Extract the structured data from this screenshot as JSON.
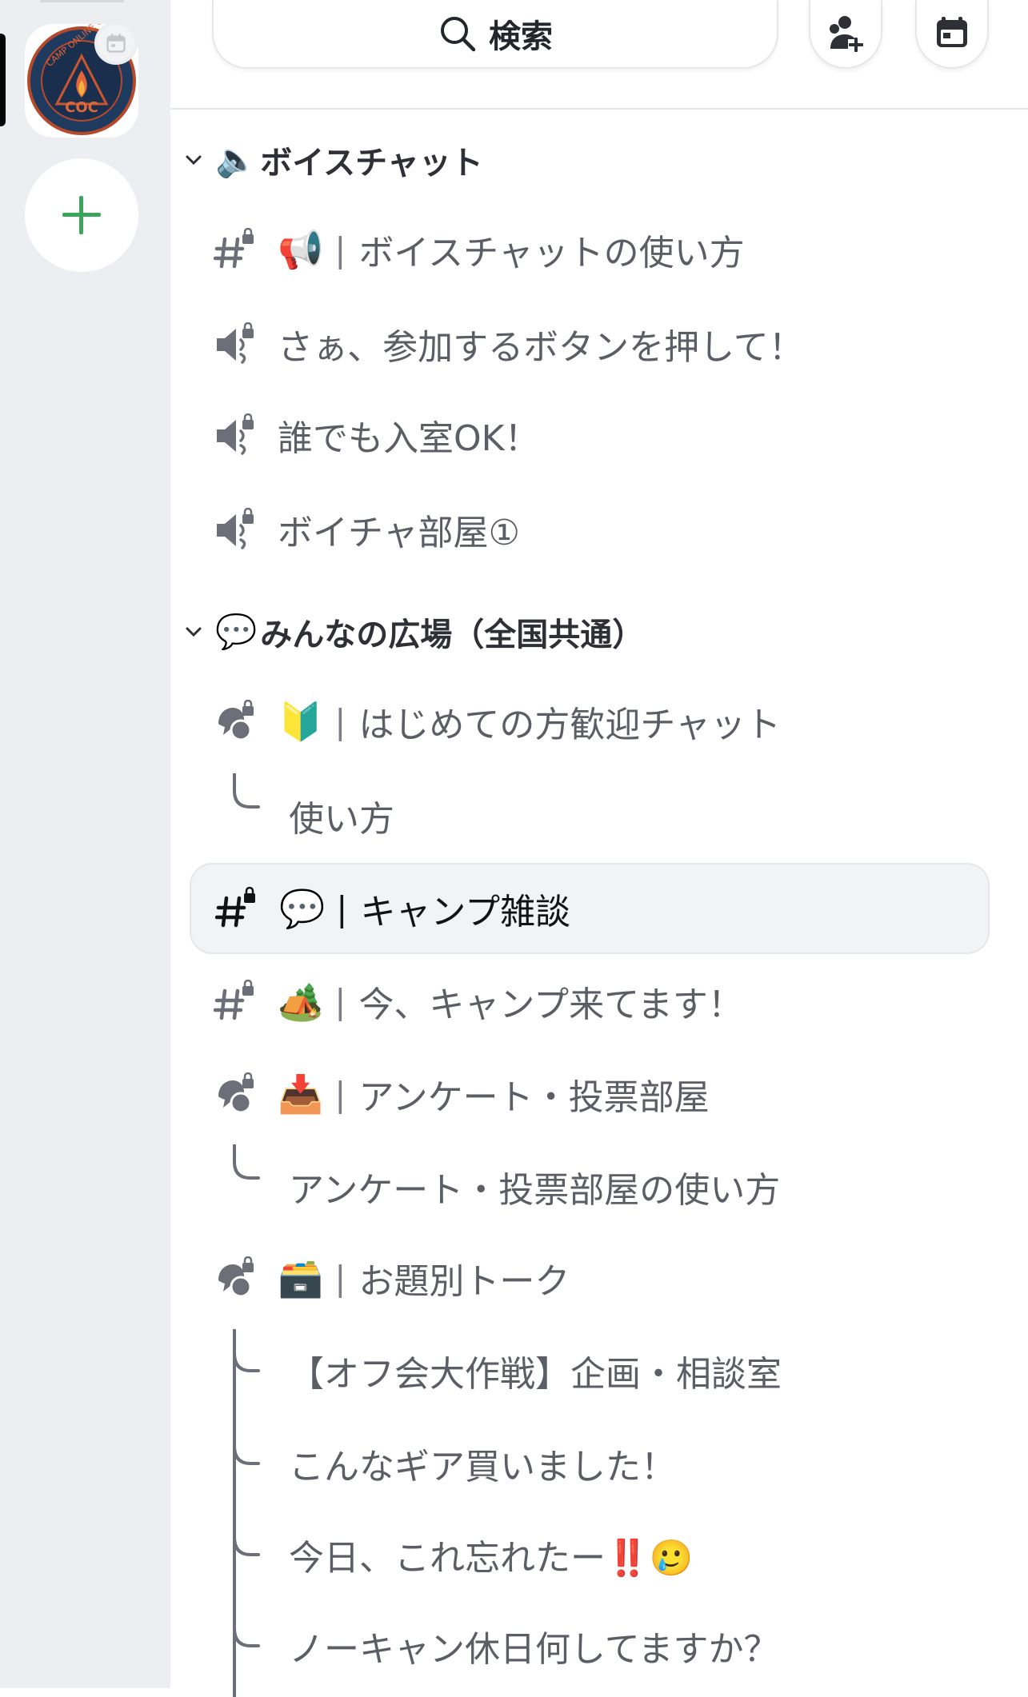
{
  "header": {
    "search_label": "検索"
  },
  "rail": {
    "server_logo_text": "COC",
    "server_logo_ring_text": "CAMP ONLINE C"
  },
  "categories": [
    {
      "label": "ボイスチャット",
      "emoji": "🔈",
      "channels": [
        {
          "type": "text-locked",
          "emoji": "📢",
          "name": "ボイスチャットの使い方"
        },
        {
          "type": "voice-locked",
          "emoji": "",
          "name": "さぁ、参加するボタンを押して！"
        },
        {
          "type": "voice-locked",
          "emoji": "",
          "name": "誰でも入室OK！"
        },
        {
          "type": "voice-locked",
          "emoji": "",
          "name": "ボイチャ部屋①"
        }
      ]
    },
    {
      "label": "みんなの広場（全国共通）",
      "emoji": "💬",
      "channels": [
        {
          "type": "forum-locked",
          "emoji": "🔰",
          "name": "はじめての方歓迎チャット"
        },
        {
          "type": "thread",
          "name": "使い方"
        },
        {
          "type": "text-locked",
          "emoji": "💬",
          "name": "キャンプ雑談",
          "selected": true
        },
        {
          "type": "text-locked",
          "emoji": "🏕️",
          "name": "今、キャンプ来てます！"
        },
        {
          "type": "forum-locked",
          "emoji": "📥",
          "name": "アンケート・投票部屋"
        },
        {
          "type": "thread",
          "name": "アンケート・投票部屋の使い方"
        },
        {
          "type": "forum-locked",
          "emoji": "🗃️",
          "name": "お題別トーク"
        },
        {
          "type": "thread",
          "name": "【オフ会大作戦】企画・相談室"
        },
        {
          "type": "thread",
          "name": "こんなギア買いました！"
        },
        {
          "type": "thread",
          "name": "今日、これ忘れたー‼️🥲"
        },
        {
          "type": "thread",
          "name": "ノーキャン休日何してますか？"
        }
      ]
    }
  ],
  "colors": {
    "rail_bg": "#eceef1",
    "accent_green": "#3ba55c",
    "selected_bg": "#f2f3f5",
    "text_muted": "#5c5e66"
  }
}
